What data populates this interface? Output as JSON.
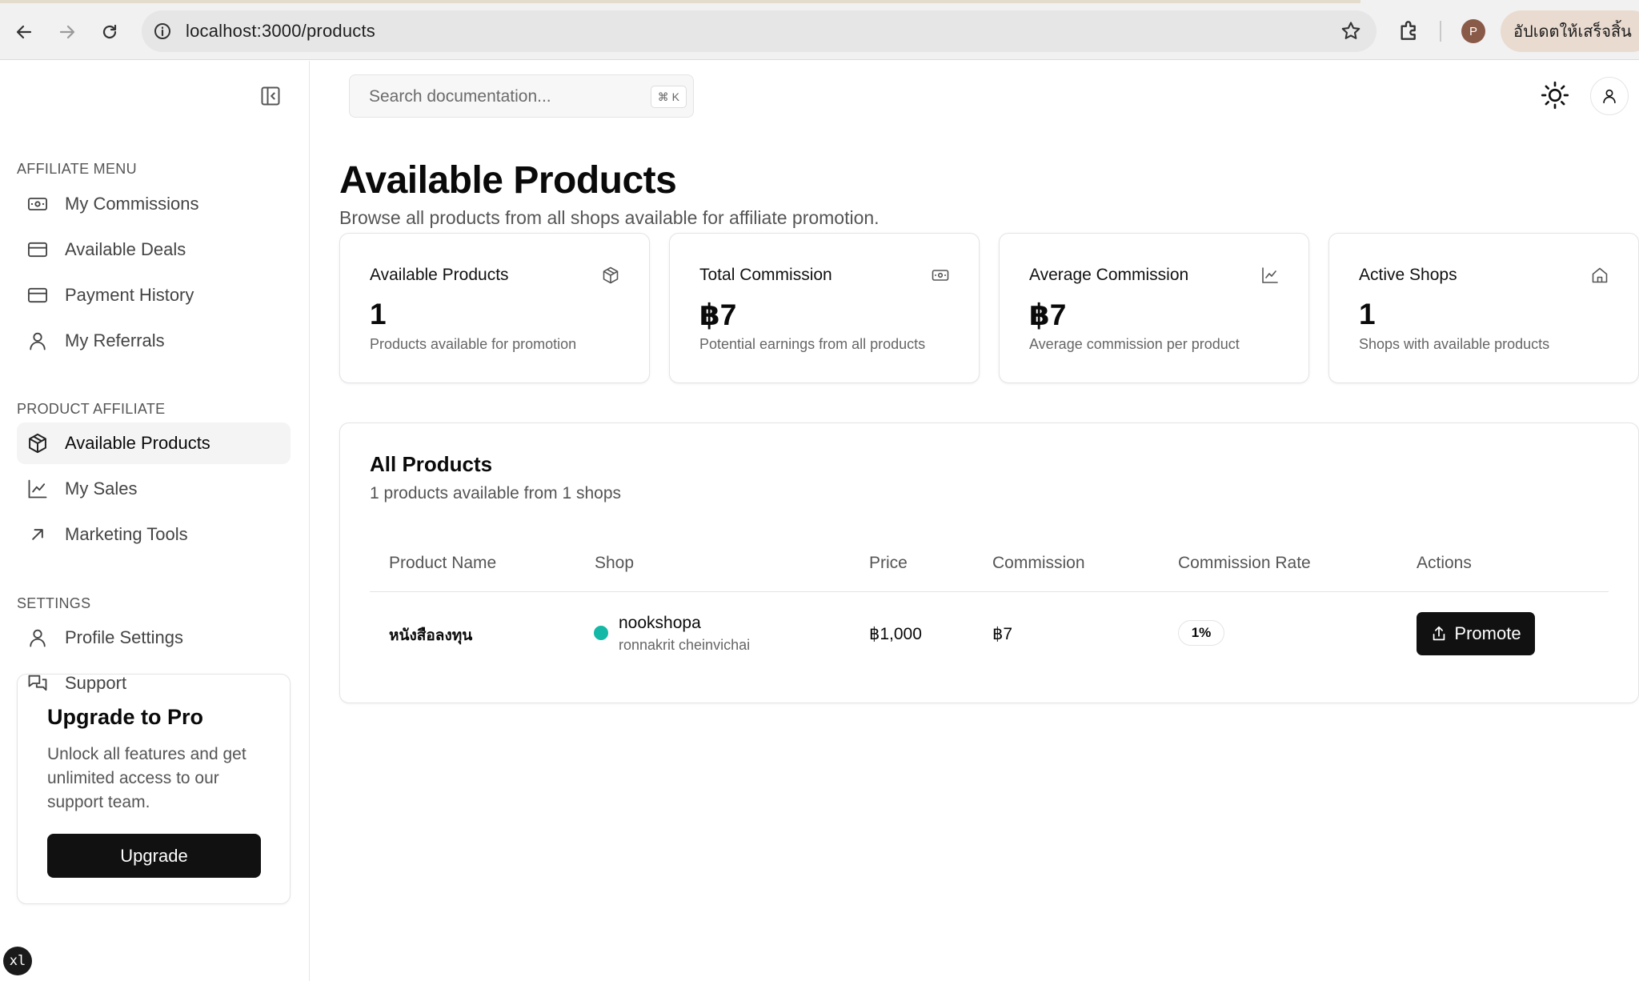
{
  "browser": {
    "url": "localhost:3000/products",
    "profile_initial": "P",
    "update_label": "อัปเดตให้เสร็จสิ้น"
  },
  "sidebar": {
    "affiliate_menu_label": "AFFILIATE MENU",
    "affiliate_items": [
      {
        "label": "My Commissions",
        "icon": "money-icon"
      },
      {
        "label": "Available Deals",
        "icon": "card-icon"
      },
      {
        "label": "Payment History",
        "icon": "card-icon"
      },
      {
        "label": "My Referrals",
        "icon": "user-icon"
      }
    ],
    "product_affiliate_label": "PRODUCT AFFILIATE",
    "product_items": [
      {
        "label": "Available Products",
        "icon": "box-icon",
        "active": true
      },
      {
        "label": "My Sales",
        "icon": "chart-line-icon"
      },
      {
        "label": "Marketing Tools",
        "icon": "arrow-up-right-icon"
      }
    ],
    "settings_label": "SETTINGS",
    "settings_items": [
      {
        "label": "Profile Settings",
        "icon": "user-icon"
      },
      {
        "label": "Support",
        "icon": "chat-icon"
      }
    ],
    "upgrade": {
      "title": "Upgrade to Pro",
      "description": "Unlock all features and get unlimited access to our support team.",
      "button": "Upgrade"
    },
    "badge": "xl"
  },
  "header": {
    "search_placeholder": "Search documentation...",
    "search_shortcut": "⌘ K"
  },
  "page": {
    "title": "Available Products",
    "subtitle": "Browse all products from all shops available for affiliate promotion."
  },
  "stats": [
    {
      "title": "Available Products",
      "value": "1",
      "note": "Products available for promotion",
      "icon": "box-icon"
    },
    {
      "title": "Total Commission",
      "value": "฿7",
      "note": "Potential earnings from all products",
      "icon": "money-icon"
    },
    {
      "title": "Average Commission",
      "value": "฿7",
      "note": "Average commission per product",
      "icon": "chart-line-icon"
    },
    {
      "title": "Active Shops",
      "value": "1",
      "note": "Shops with available products",
      "icon": "store-icon"
    }
  ],
  "products": {
    "title": "All Products",
    "subtitle": "1 products available from 1 shops",
    "columns": [
      "Product Name",
      "Shop",
      "Price",
      "Commission",
      "Commission Rate",
      "Actions"
    ],
    "rows": [
      {
        "name": "หนังสือลงทุน",
        "shop_name": "nookshopa",
        "shop_owner": "ronnakrit cheinvichai",
        "price": "฿1,000",
        "commission": "฿7",
        "rate": "1%",
        "action": "Promote",
        "shop_status_color": "#14b8a6"
      }
    ]
  }
}
